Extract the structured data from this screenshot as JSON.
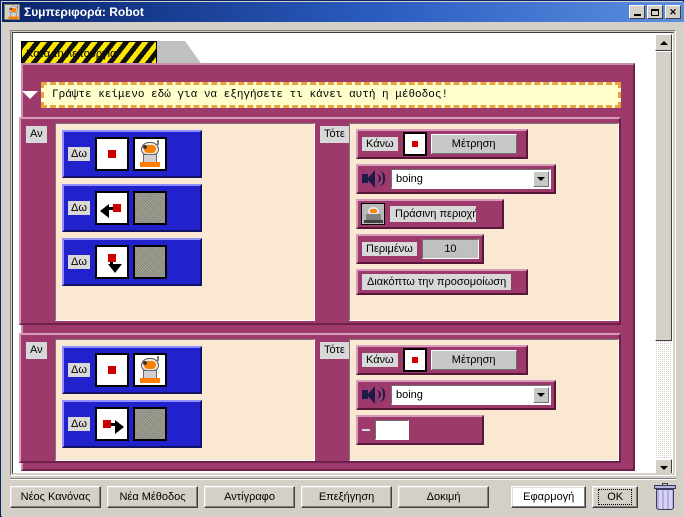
{
  "window": {
    "title": "Συμπεριφορά: Robot",
    "icon": "robot-icon",
    "buttons": {
      "minimize": "minimize-icon",
      "maximize": "maximize-icon",
      "close": "close-icon"
    }
  },
  "tab": {
    "label": "Κατά τη λειτουργία"
  },
  "comment": {
    "toggle": "collapse-triangle-icon",
    "text": "Γράψτε κείμενο εδώ για να εξηγήσετε τι κάνει αυτή η μέθοδος!"
  },
  "labels": {
    "if": "Αν",
    "then": "Τότε",
    "see": "Δω",
    "do": "Κάνω"
  },
  "rules": [
    {
      "if_label": "Αν",
      "then_label": "Τότε",
      "conditions": [
        {
          "verb": "Δω",
          "direction": "center",
          "target": "robot-sprite"
        },
        {
          "verb": "Δω",
          "direction": "left",
          "target": "ground-tile"
        },
        {
          "verb": "Δω",
          "direction": "down",
          "target": "ground-tile"
        }
      ],
      "actions": [
        {
          "type": "do",
          "verb": "Κάνω",
          "direction": "center",
          "value": "Μέτρηση"
        },
        {
          "type": "sound",
          "icon": "speaker-icon",
          "value": "boing"
        },
        {
          "type": "method",
          "icon": "area-icon",
          "value": "Πράσινη περιοχή"
        },
        {
          "type": "wait",
          "verb": "Περιμένω",
          "value": "10"
        },
        {
          "type": "stop",
          "value": "Διακόπτω την προσομοίωση"
        }
      ]
    },
    {
      "if_label": "Αν",
      "then_label": "Τότε",
      "conditions": [
        {
          "verb": "Δω",
          "direction": "center",
          "target": "robot-sprite"
        },
        {
          "verb": "Δω",
          "direction": "right",
          "target": "ground-tile"
        }
      ],
      "actions": [
        {
          "type": "do",
          "verb": "Κάνω",
          "direction": "center",
          "value": "Μέτρηση"
        },
        {
          "type": "sound",
          "icon": "speaker-icon",
          "value": "boing"
        },
        {
          "type": "wait",
          "verb": "",
          "value": ""
        }
      ]
    }
  ],
  "scrollbar": {
    "up": "scroll-up-icon",
    "down": "scroll-down-icon"
  },
  "footer": {
    "buttons": [
      {
        "name": "new-rule",
        "label": "Νέος Κανόνας"
      },
      {
        "name": "new-method",
        "label": "Νέα Μέθοδος"
      },
      {
        "name": "copy",
        "label": "Αντίγραφο"
      },
      {
        "name": "explain",
        "label": "Επεξήγηση"
      },
      {
        "name": "test",
        "label": "Δοκιμή"
      }
    ],
    "apply": "Εφαρμογή",
    "ok": "OK",
    "trash": "trash-icon"
  },
  "colors": {
    "title_start": "#0a246a",
    "title_end": "#5b8fe0",
    "rule_plum": "#9d3a6b",
    "cond_blue": "#2222cc",
    "panel_cream": "#fbe8d2",
    "comment_bg": "#ffffcc",
    "comment_border": "#e8a33d",
    "face": "#d4d0c8"
  }
}
